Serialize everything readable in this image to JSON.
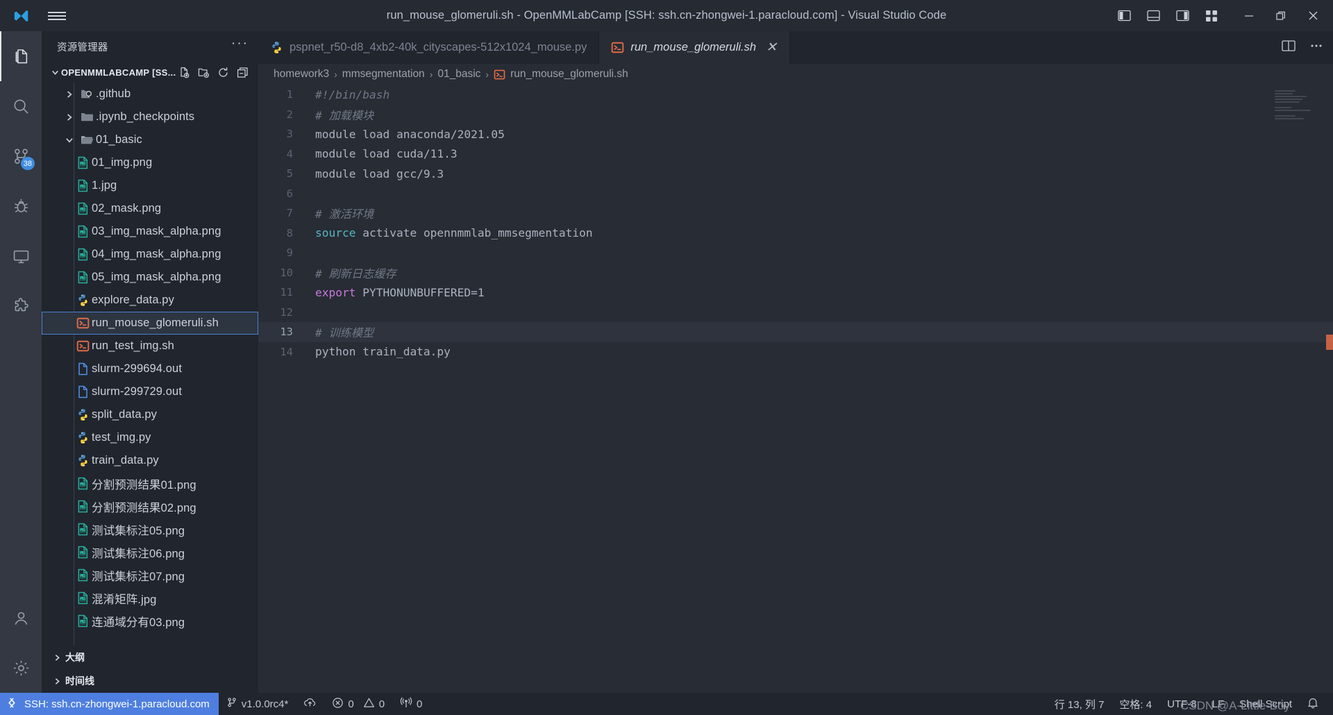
{
  "window": {
    "title": "run_mouse_glomeruli.sh - OpenMMLabCamp [SSH: ssh.cn-zhongwei-1.paracloud.com] - Visual Studio Code",
    "controls": {
      "toggle_primary_sidebar": "toggle-primary-sidebar",
      "toggle_panel": "toggle-panel",
      "toggle_secondary_sidebar": "toggle-secondary-sidebar",
      "customize_layout": "customize-layout",
      "minimize": "—",
      "restore": "restore",
      "close": "✕"
    }
  },
  "activitybar": {
    "items": [
      {
        "name": "explorer",
        "icon": "files-icon",
        "active": true,
        "badge": ""
      },
      {
        "name": "search",
        "icon": "search-icon",
        "active": false,
        "badge": ""
      },
      {
        "name": "source-control",
        "icon": "source-control-icon",
        "active": false,
        "badge": "38"
      },
      {
        "name": "run-and-debug",
        "icon": "debug-icon",
        "active": false,
        "badge": ""
      },
      {
        "name": "remote-explorer",
        "icon": "remote-monitor-icon",
        "active": false,
        "badge": ""
      },
      {
        "name": "extensions",
        "icon": "extensions-icon",
        "active": false,
        "badge": ""
      },
      {
        "name": "accounts",
        "icon": "account-icon",
        "active": false,
        "badge": ""
      },
      {
        "name": "manage",
        "icon": "gear-icon",
        "active": false,
        "badge": ""
      }
    ]
  },
  "sidebar": {
    "header_title": "资源管理器",
    "header_more": "···",
    "root": {
      "title": "OPENMMLABCAMP [SS...",
      "actions": [
        "new-file-icon",
        "new-folder-icon",
        "refresh-icon",
        "collapse-all-icon"
      ]
    },
    "tree": [
      {
        "label": ".github",
        "icon": "github-folder-icon",
        "type": "folder",
        "expanded": false,
        "indent": 1
      },
      {
        "label": ".ipynb_checkpoints",
        "icon": "folder-icon",
        "type": "folder",
        "expanded": false,
        "indent": 1
      },
      {
        "label": "01_basic",
        "icon": "folder-open-icon",
        "type": "folder",
        "expanded": true,
        "indent": 1
      },
      {
        "label": "01_img.png",
        "icon": "image-file-icon",
        "type": "file",
        "indent": 2
      },
      {
        "label": "1.jpg",
        "icon": "image-file-icon",
        "type": "file",
        "indent": 2
      },
      {
        "label": "02_mask.png",
        "icon": "image-file-icon",
        "type": "file",
        "indent": 2
      },
      {
        "label": "03_img_mask_alpha.png",
        "icon": "image-file-icon",
        "type": "file",
        "indent": 2
      },
      {
        "label": "04_img_mask_alpha.png",
        "icon": "image-file-icon",
        "type": "file",
        "indent": 2
      },
      {
        "label": "05_img_mask_alpha.png",
        "icon": "image-file-icon",
        "type": "file",
        "indent": 2
      },
      {
        "label": "explore_data.py",
        "icon": "python-file-icon",
        "type": "file",
        "indent": 2
      },
      {
        "label": "run_mouse_glomeruli.sh",
        "icon": "shell-file-icon",
        "type": "file",
        "indent": 2,
        "selected": true
      },
      {
        "label": "run_test_img.sh",
        "icon": "shell-file-icon",
        "type": "file",
        "indent": 2
      },
      {
        "label": "slurm-299694.out",
        "icon": "text-file-icon",
        "type": "file",
        "indent": 2
      },
      {
        "label": "slurm-299729.out",
        "icon": "text-file-icon",
        "type": "file",
        "indent": 2
      },
      {
        "label": "split_data.py",
        "icon": "python-file-icon",
        "type": "file",
        "indent": 2
      },
      {
        "label": "test_img.py",
        "icon": "python-file-icon",
        "type": "file",
        "indent": 2
      },
      {
        "label": "train_data.py",
        "icon": "python-file-icon",
        "type": "file",
        "indent": 2
      },
      {
        "label": "分割预测结果01.png",
        "icon": "image-file-icon",
        "type": "file",
        "indent": 2
      },
      {
        "label": "分割预测结果02.png",
        "icon": "image-file-icon",
        "type": "file",
        "indent": 2
      },
      {
        "label": "测试集标注05.png",
        "icon": "image-file-icon",
        "type": "file",
        "indent": 2
      },
      {
        "label": "测试集标注06.png",
        "icon": "image-file-icon",
        "type": "file",
        "indent": 2
      },
      {
        "label": "测试集标注07.png",
        "icon": "image-file-icon",
        "type": "file",
        "indent": 2
      },
      {
        "label": "混淆矩阵.jpg",
        "icon": "image-file-icon",
        "type": "file",
        "indent": 2
      },
      {
        "label": "连通域分有03.png",
        "icon": "image-file-icon",
        "type": "file",
        "indent": 2
      }
    ],
    "bottom_sections": [
      {
        "label": "大纲",
        "expanded": false
      },
      {
        "label": "时间线",
        "expanded": false
      }
    ]
  },
  "editor": {
    "tabs": [
      {
        "label": "pspnet_r50-d8_4xb2-40k_cityscapes-512x1024_mouse.py",
        "icon": "python-file-icon",
        "active": false,
        "closable": false
      },
      {
        "label": "run_mouse_glomeruli.sh",
        "icon": "shell-file-icon",
        "active": true,
        "closable": true,
        "close_glyph": "✕"
      }
    ],
    "tabbar_actions": [
      "split-editor-icon",
      "more-actions-icon"
    ],
    "breadcrumb": [
      {
        "label": "homework3",
        "icon": ""
      },
      {
        "label": "mmsegmentation",
        "icon": ""
      },
      {
        "label": "01_basic",
        "icon": ""
      },
      {
        "label": "run_mouse_glomeruli.sh",
        "icon": "shell-file-icon"
      }
    ],
    "breadcrumb_separator": "›",
    "current_line": 13,
    "lines": [
      {
        "n": "1",
        "tokens": [
          {
            "t": "#!/bin/bash",
            "c": "c-comment"
          }
        ]
      },
      {
        "n": "2",
        "tokens": [
          {
            "t": "# 加载模块",
            "c": "c-comment"
          }
        ]
      },
      {
        "n": "3",
        "tokens": [
          {
            "t": "module load anaconda/2021.05",
            "c": "c-plain"
          }
        ]
      },
      {
        "n": "4",
        "tokens": [
          {
            "t": "module load cuda/11.3",
            "c": "c-plain"
          }
        ]
      },
      {
        "n": "5",
        "tokens": [
          {
            "t": "module load gcc/9.3",
            "c": "c-plain"
          }
        ]
      },
      {
        "n": "6",
        "tokens": []
      },
      {
        "n": "7",
        "tokens": [
          {
            "t": "# 激活环境",
            "c": "c-comment"
          }
        ]
      },
      {
        "n": "8",
        "tokens": [
          {
            "t": "source",
            "c": "c-fn"
          },
          {
            "t": " activate opennmmlab_mmsegmentation",
            "c": "c-plain"
          }
        ]
      },
      {
        "n": "9",
        "tokens": []
      },
      {
        "n": "10",
        "tokens": [
          {
            "t": "# 刷新日志缓存",
            "c": "c-comment"
          }
        ]
      },
      {
        "n": "11",
        "tokens": [
          {
            "t": "export",
            "c": "c-kw"
          },
          {
            "t": " PYTHONUNBUFFERED=1",
            "c": "c-plain"
          }
        ]
      },
      {
        "n": "12",
        "tokens": []
      },
      {
        "n": "13",
        "tokens": [
          {
            "t": "# 训练模型",
            "c": "c-comment"
          }
        ]
      },
      {
        "n": "14",
        "tokens": [
          {
            "t": "python train_data.py",
            "c": "c-plain"
          }
        ]
      }
    ]
  },
  "statusbar": {
    "remote": {
      "icon": "remote-indicator-icon",
      "label": "SSH: ssh.cn-zhongwei-1.paracloud.com"
    },
    "left_items": [
      {
        "icon": "source-control-icon",
        "label": "v1.0.0rc4*"
      },
      {
        "icon": "cloud-upload-icon",
        "label": ""
      },
      {
        "icon": "error-icon",
        "label": "0",
        "icon2": "warning-icon",
        "label2": "0"
      },
      {
        "icon": "radio-tower-icon",
        "label": "0"
      }
    ],
    "right_items": [
      {
        "label": "行 13, 列 7"
      },
      {
        "label": "空格: 4"
      },
      {
        "label": "UTF-8"
      },
      {
        "label": "LF"
      },
      {
        "label": "Shell Script"
      },
      {
        "icon": "bell-icon",
        "label": ""
      }
    ],
    "watermark": "CSDN @A-Little-Boy"
  },
  "colors": {
    "accent_blue": "#4e7fe0",
    "shell_orange": "#e06c49",
    "image_green": "#29b09d",
    "editor_bg": "#282c34",
    "sidebar_bg": "#21252e",
    "activitybar_bg": "#333842"
  }
}
